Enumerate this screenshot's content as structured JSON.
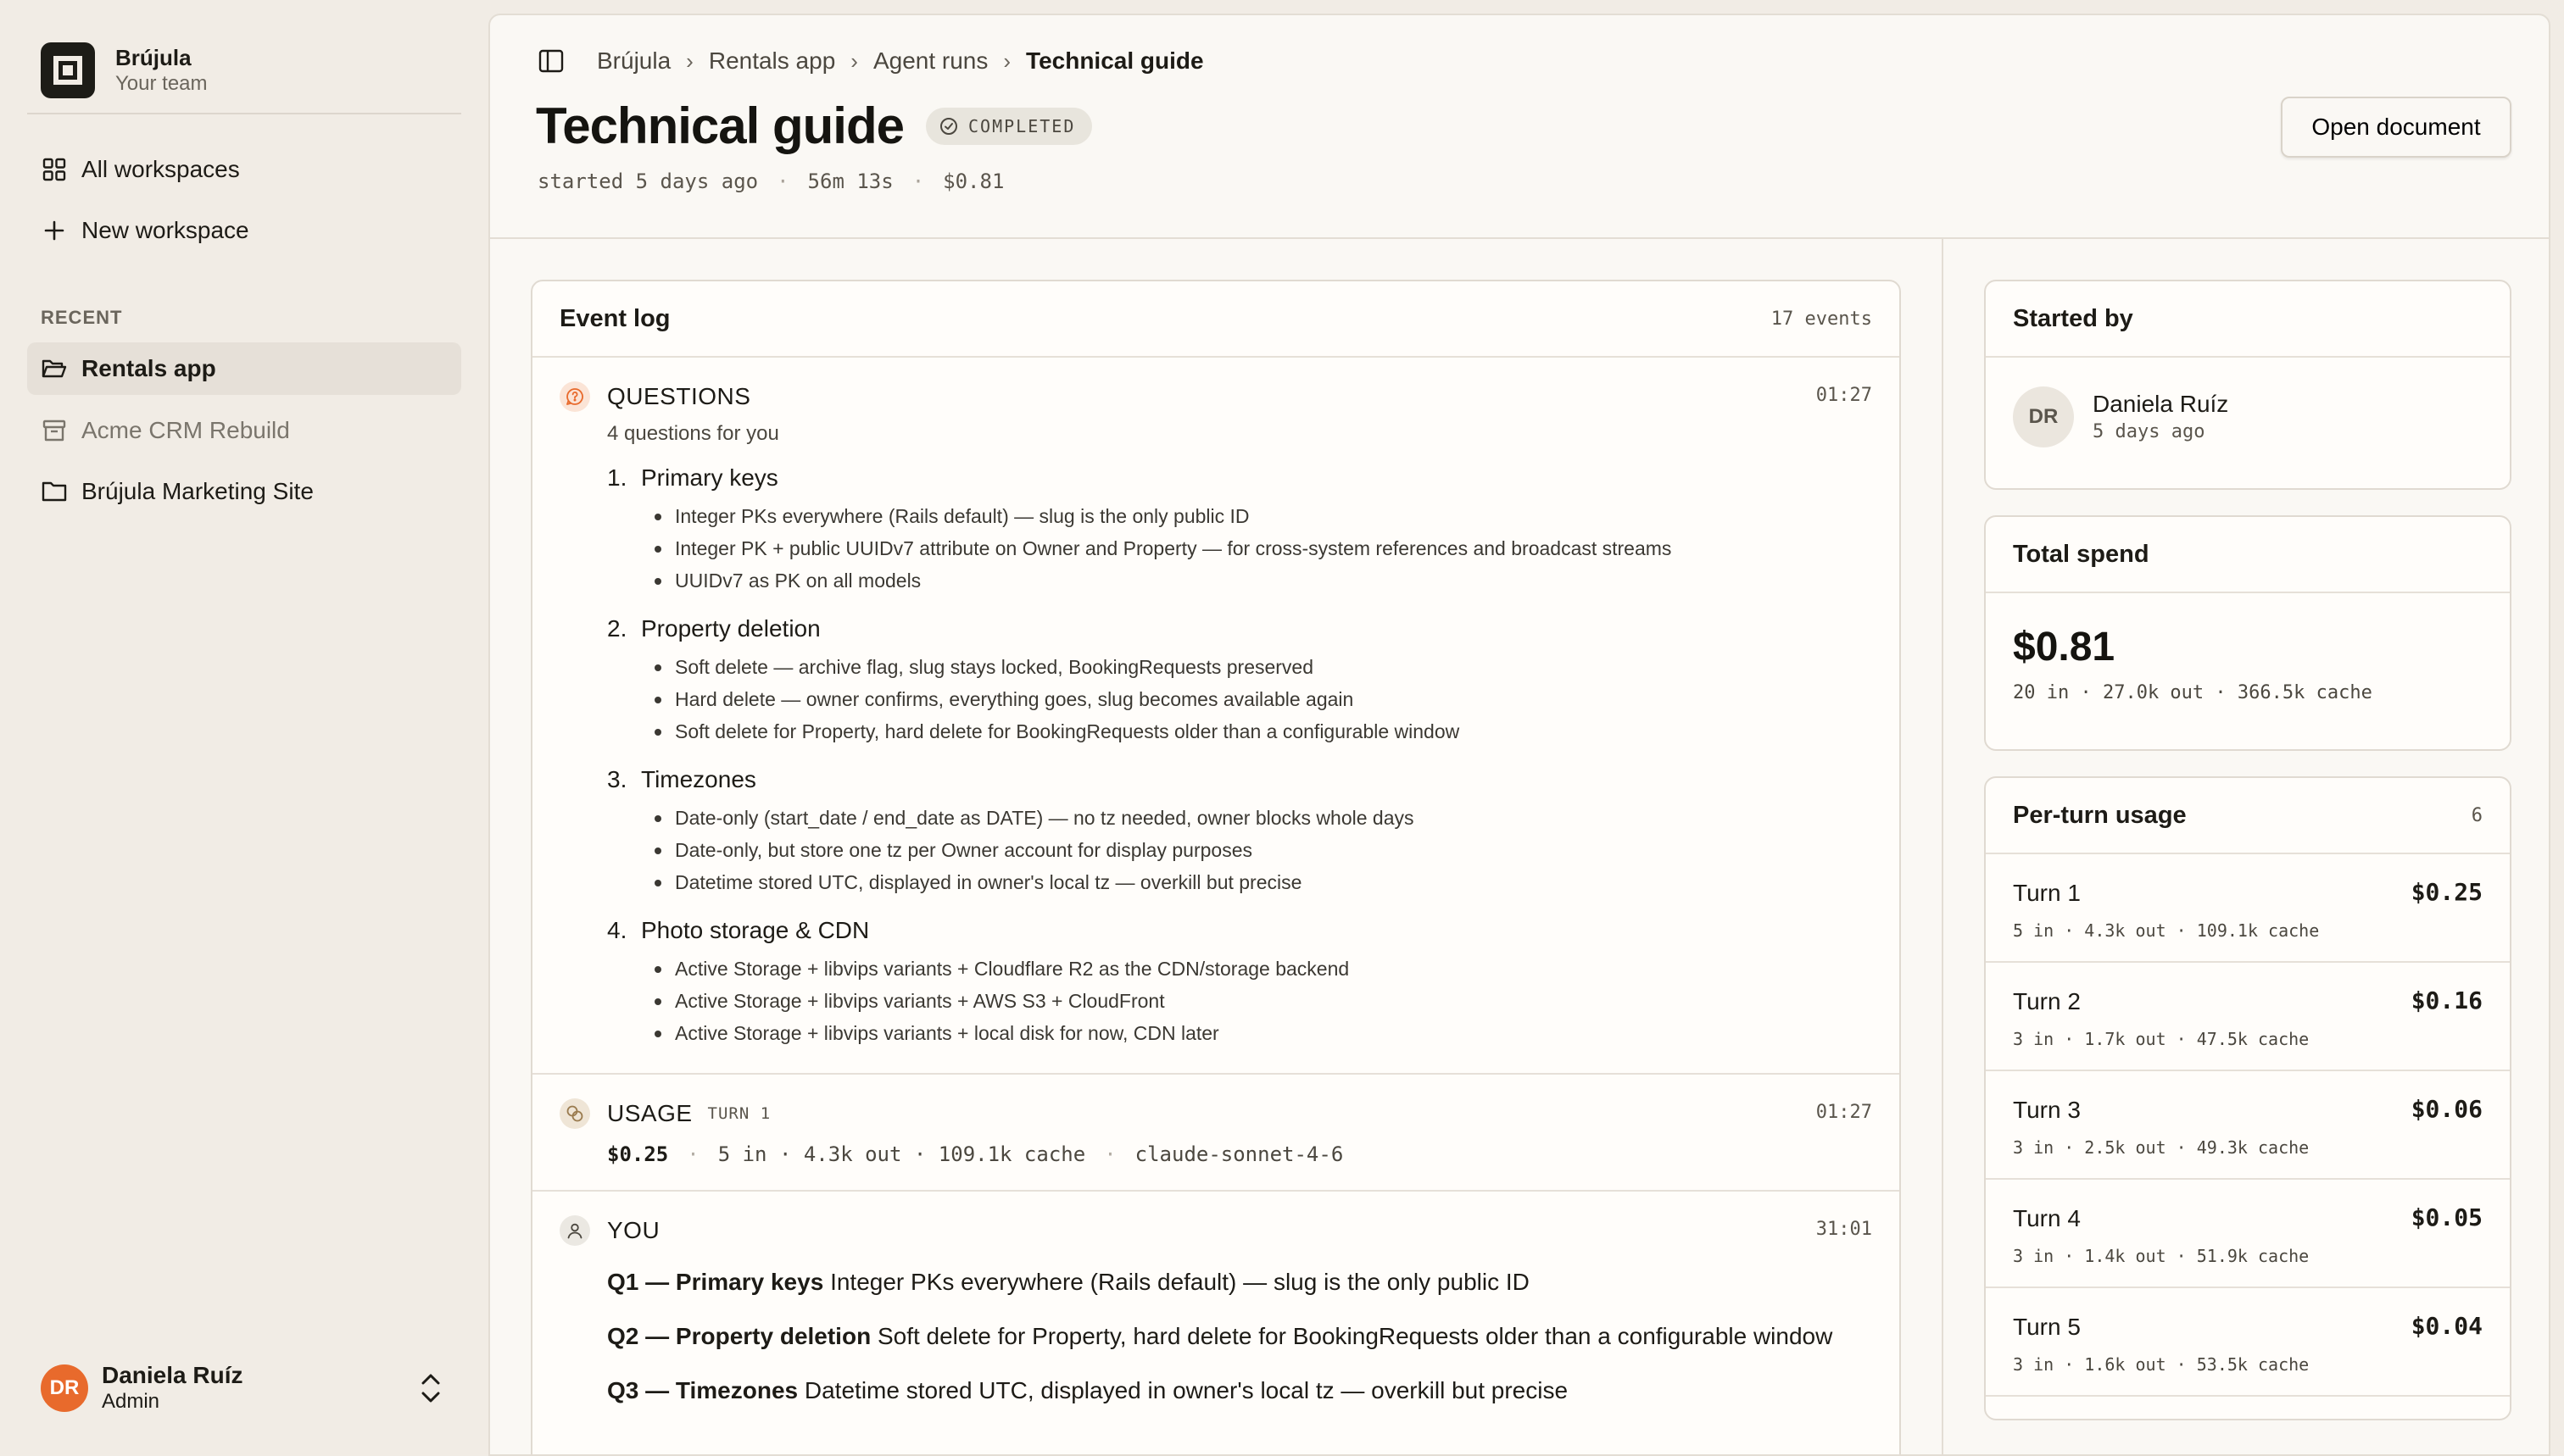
{
  "sidebar": {
    "brand": {
      "name": "Brújula",
      "team": "Your team"
    },
    "nav": [
      {
        "label": "All workspaces",
        "icon": "grid-icon"
      },
      {
        "label": "New workspace",
        "icon": "plus-icon"
      }
    ],
    "recent_label": "RECENT",
    "recent": [
      {
        "label": "Rentals app",
        "icon": "folder-open-icon",
        "active": true
      },
      {
        "label": "Acme CRM Rebuild",
        "icon": "archive-icon",
        "active": false
      },
      {
        "label": "Brújula Marketing Site",
        "icon": "folder-icon",
        "active": false
      }
    ],
    "user": {
      "initials": "DR",
      "name": "Daniela Ruíz",
      "role": "Admin"
    }
  },
  "header": {
    "breadcrumbs": [
      "Brújula",
      "Rentals app",
      "Agent runs",
      "Technical guide"
    ],
    "title": "Technical guide",
    "status": "COMPLETED",
    "meta": {
      "started": "started 5 days ago",
      "duration": "56m 13s",
      "cost": "$0.81"
    },
    "open_document": "Open document"
  },
  "event_log": {
    "title": "Event log",
    "count": "17 events",
    "questions": {
      "type": "QUESTIONS",
      "time": "01:27",
      "intro": "4 questions for you",
      "items": [
        {
          "num": "1.",
          "title": "Primary keys",
          "options": [
            "Integer PKs everywhere (Rails default) — slug is the only public ID",
            "Integer PK + public UUIDv7 attribute on Owner and Property — for cross-system references and broadcast streams",
            "UUIDv7 as PK on all models"
          ]
        },
        {
          "num": "2.",
          "title": "Property deletion",
          "options": [
            "Soft delete — archive flag, slug stays locked, BookingRequests preserved",
            "Hard delete — owner confirms, everything goes, slug becomes available again",
            "Soft delete for Property, hard delete for BookingRequests older than a configurable window"
          ]
        },
        {
          "num": "3.",
          "title": "Timezones",
          "options": [
            "Date-only (start_date / end_date as DATE) — no tz needed, owner blocks whole days",
            "Date-only, but store one tz per Owner account for display purposes",
            "Datetime stored UTC, displayed in owner's local tz — overkill but precise"
          ]
        },
        {
          "num": "4.",
          "title": "Photo storage & CDN",
          "options": [
            "Active Storage + libvips variants + Cloudflare R2 as the CDN/storage backend",
            "Active Storage + libvips variants + AWS S3 + CloudFront",
            "Active Storage + libvips variants + local disk for now, CDN later"
          ]
        }
      ]
    },
    "usage": {
      "type": "USAGE",
      "sub": "TURN 1",
      "time": "01:27",
      "cost": "$0.25",
      "tokens": "5 in · 4.3k out · 109.1k cache",
      "model": "claude-sonnet-4-6"
    },
    "you": {
      "type": "YOU",
      "time": "31:01",
      "answers": [
        {
          "label": "Q1 — Primary keys",
          "text": "Integer PKs everywhere (Rails default) — slug is the only public ID"
        },
        {
          "label": "Q2 — Property deletion",
          "text": "Soft delete for Property, hard delete for BookingRequests older than a configurable window"
        },
        {
          "label": "Q3 — Timezones",
          "text": "Datetime stored UTC, displayed in owner's local tz — overkill but precise"
        }
      ]
    }
  },
  "started_by": {
    "title": "Started by",
    "initials": "DR",
    "name": "Daniela Ruíz",
    "when": "5 days ago"
  },
  "total_spend": {
    "title": "Total spend",
    "amount": "$0.81",
    "detail": "20 in · 27.0k out · 366.5k cache"
  },
  "per_turn": {
    "title": "Per-turn usage",
    "count": "6",
    "turns": [
      {
        "name": "Turn 1",
        "cost": "$0.25",
        "detail": "5 in · 4.3k out · 109.1k cache"
      },
      {
        "name": "Turn 2",
        "cost": "$0.16",
        "detail": "3 in · 1.7k out · 47.5k cache"
      },
      {
        "name": "Turn 3",
        "cost": "$0.06",
        "detail": "3 in · 2.5k out · 49.3k cache"
      },
      {
        "name": "Turn 4",
        "cost": "$0.05",
        "detail": "3 in · 1.4k out · 51.9k cache"
      },
      {
        "name": "Turn 5",
        "cost": "$0.04",
        "detail": "3 in · 1.6k out · 53.5k cache"
      }
    ]
  },
  "colors": {
    "accent": "#e86a2c",
    "background": "#f1ece5",
    "panel": "#faf8f4"
  }
}
